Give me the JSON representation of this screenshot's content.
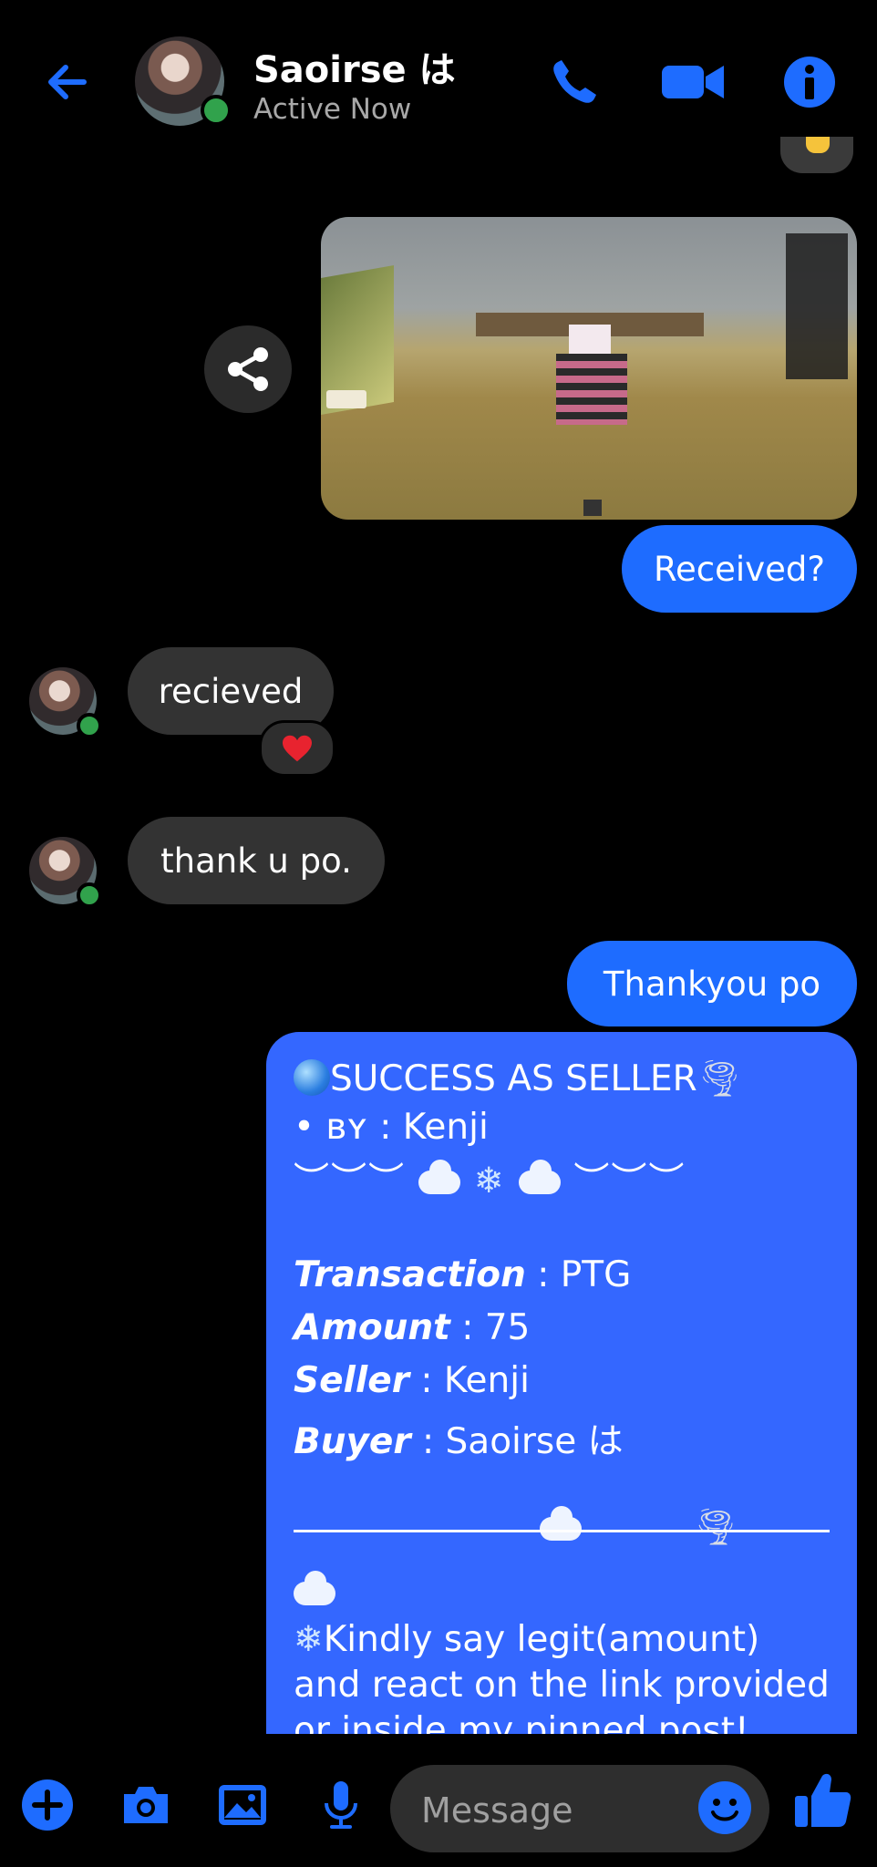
{
  "header": {
    "contact_name": "Saoirse は",
    "status": "Active Now"
  },
  "messages": {
    "sent_received": "Received?",
    "recv_recieved": "recieved",
    "recv_thanku": "thank u po.",
    "sent_thankyou": "Thankyou po",
    "reaction_emoji": "❤️"
  },
  "receipt": {
    "title": "SUCCESS AS SELLER",
    "by_label": "• ʙʏ : Kenji",
    "deco_line": "︶︶︶",
    "transaction_label": "Transaction",
    "transaction_value": " : PTG",
    "amount_label": "Amount",
    "amount_value": " : 75",
    "seller_label": "Seller",
    "seller_value": " : Kenji",
    "buyer_label": "Buyer",
    "buyer_value": " : Saoirse は",
    "note_line1": "Kindly say legit(amount)",
    "note_line2": "and react on the link provided",
    "note_line3": "or inside my pinned post!"
  },
  "composer": {
    "placeholder": "Message"
  },
  "colors": {
    "accent": "#1e6cff",
    "receipt_bg": "#3467ff",
    "recv_bubble": "#333333",
    "online": "#31a24c"
  },
  "icons": {
    "back": "arrow-left-icon",
    "call": "phone-icon",
    "video": "video-camera-icon",
    "info": "info-icon",
    "share": "share-icon",
    "plus": "plus-icon",
    "camera": "camera-icon",
    "gallery": "image-icon",
    "mic": "microphone-icon",
    "emoji": "smiley-icon",
    "like": "thumbs-up-icon"
  }
}
